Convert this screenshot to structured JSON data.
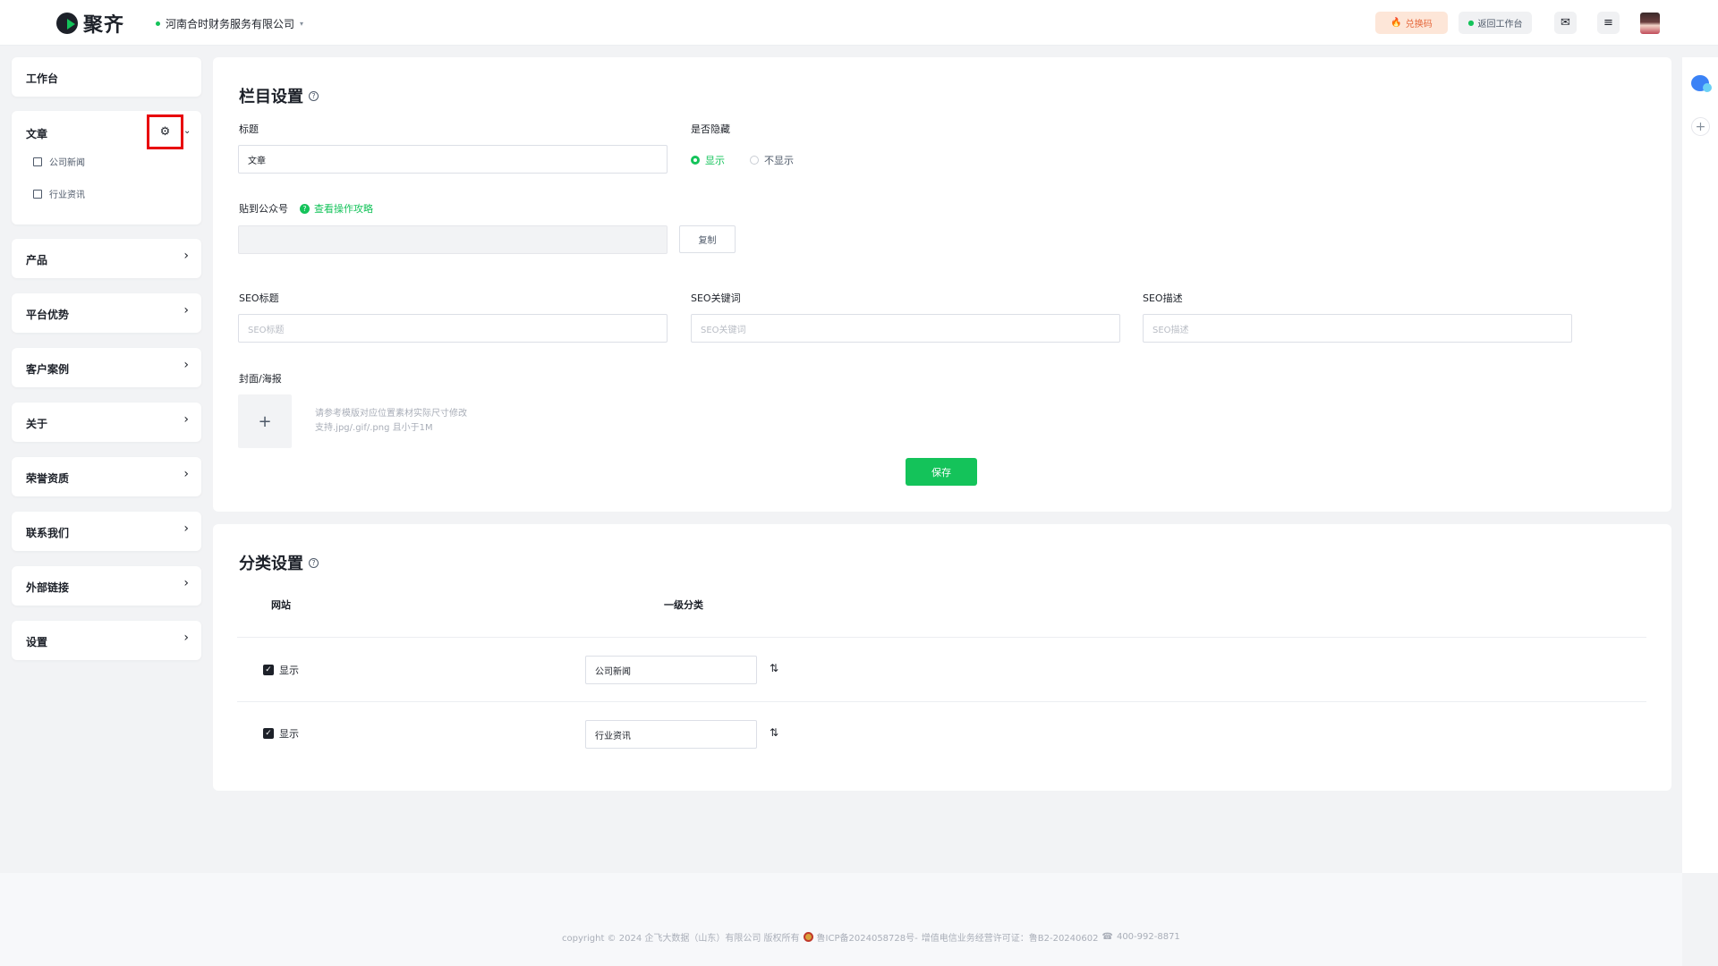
{
  "header": {
    "logo_text": "聚齐",
    "company_name": "河南合时财务服务有限公司",
    "redeem_label": "兑换码",
    "back_label": "返回工作台",
    "brand_color": "#14c35a"
  },
  "sidebar": {
    "workbench": "工作台",
    "article": {
      "label": "文章",
      "children": [
        "公司新闻",
        "行业资讯"
      ]
    },
    "items": [
      "产品",
      "平台优势",
      "客户案例",
      "关于",
      "荣誉资质",
      "联系我们",
      "外部链接",
      "设置"
    ]
  },
  "column_settings": {
    "title": "栏目设置",
    "title_label": "标题",
    "title_value": "文章",
    "hide_label": "是否隐藏",
    "radio_show": "显示",
    "radio_hide": "不显示",
    "selected": "显示",
    "wechat_label": "贴到公众号",
    "guide_link": "查看操作攻略",
    "wechat_value": "",
    "copy_button": "复制",
    "seo_title_label": "SEO标题",
    "seo_title_placeholder": "SEO标题",
    "seo_keywords_label": "SEO关键词",
    "seo_keywords_placeholder": "SEO关键词",
    "seo_desc_label": "SEO描述",
    "seo_desc_placeholder": "SEO描述",
    "cover_label": "封面/海报",
    "cover_hint_1": "请参考模版对应位置素材实际尺寸修改",
    "cover_hint_2": "支持.jpg/.gif/.png 且小于1M",
    "save_button": "保存"
  },
  "category_settings": {
    "title": "分类设置",
    "col_site": "网站",
    "col_level1": "一级分类",
    "rows": [
      {
        "checked": true,
        "show_label": "显示",
        "name": "公司新闻"
      },
      {
        "checked": true,
        "show_label": "显示",
        "name": "行业资讯"
      }
    ]
  },
  "footer": {
    "copyright": "copyright © 2024 企飞大数据（山东）有限公司 版权所有",
    "icp": "鲁ICP备2024058728号-",
    "license": "增值电信业务经营许可证：鲁B2-20240602",
    "phone": "400-992-8871"
  }
}
